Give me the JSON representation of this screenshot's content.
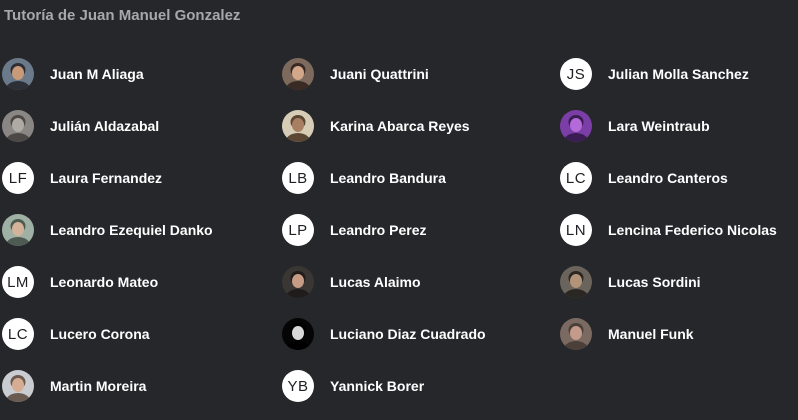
{
  "page": {
    "title": "Tutoría de Juan Manuel Gonzalez"
  },
  "members": [
    {
      "name": "Juan M Aliaga",
      "avatar": {
        "kind": "photo",
        "colors": [
          "#6b7a8a",
          "#c89a78",
          "#2c2f36"
        ]
      }
    },
    {
      "name": "Juani Quattrini",
      "avatar": {
        "kind": "photo",
        "colors": [
          "#7d6a5d",
          "#d2a78a",
          "#3a2a24"
        ]
      }
    },
    {
      "name": "Julian Molla Sanchez",
      "avatar": {
        "kind": "initials",
        "initials": "JS"
      }
    },
    {
      "name": "Julián Aldazabal",
      "avatar": {
        "kind": "photo",
        "colors": [
          "#8a8683",
          "#b0aaa4",
          "#4b4846"
        ]
      }
    },
    {
      "name": "Karina Abarca Reyes",
      "avatar": {
        "kind": "photo",
        "colors": [
          "#d7cdb7",
          "#a87f62",
          "#5b4634"
        ]
      }
    },
    {
      "name": "Lara Weintraub",
      "avatar": {
        "kind": "photo",
        "colors": [
          "#7b3ea6",
          "#b46ad8",
          "#3a1d52"
        ]
      }
    },
    {
      "name": "Laura Fernandez",
      "avatar": {
        "kind": "initials",
        "initials": "LF"
      }
    },
    {
      "name": "Leandro Bandura",
      "avatar": {
        "kind": "initials",
        "initials": "LB"
      }
    },
    {
      "name": "Leandro Canteros",
      "avatar": {
        "kind": "initials",
        "initials": "LC"
      }
    },
    {
      "name": "Leandro Ezequiel Danko",
      "avatar": {
        "kind": "photo",
        "colors": [
          "#9fb1a4",
          "#d3b39a",
          "#4e5b52"
        ]
      }
    },
    {
      "name": "Leandro Perez",
      "avatar": {
        "kind": "initials",
        "initials": "LP"
      }
    },
    {
      "name": "Lencina Federico Nicolas",
      "avatar": {
        "kind": "initials",
        "initials": "LN"
      }
    },
    {
      "name": "Leonardo Mateo",
      "avatar": {
        "kind": "initials",
        "initials": "LM"
      }
    },
    {
      "name": "Lucas Alaimo",
      "avatar": {
        "kind": "photo",
        "colors": [
          "#3a3634",
          "#c79c84",
          "#1f1c1b"
        ]
      }
    },
    {
      "name": "Lucas Sordini",
      "avatar": {
        "kind": "photo",
        "colors": [
          "#6a645c",
          "#b39479",
          "#2a2622"
        ]
      }
    },
    {
      "name": "Lucero Corona",
      "avatar": {
        "kind": "initials",
        "initials": "LC"
      }
    },
    {
      "name": "Luciano Diaz Cuadrado",
      "avatar": {
        "kind": "photo",
        "colors": [
          "#050505",
          "#d8d8d8",
          "#000000"
        ]
      }
    },
    {
      "name": "Manuel Funk",
      "avatar": {
        "kind": "photo",
        "colors": [
          "#7b6a62",
          "#c49b8a",
          "#4b3f3a"
        ]
      }
    },
    {
      "name": "Martin Moreira",
      "avatar": {
        "kind": "photo",
        "colors": [
          "#c9ccd1",
          "#d6ad93",
          "#6a5a4f"
        ]
      }
    },
    {
      "name": "Yannick Borer",
      "avatar": {
        "kind": "initials",
        "initials": "YB"
      }
    }
  ],
  "theme": {
    "background": "#26272b",
    "title_color": "#a7a8ab",
    "name_color": "#ffffff",
    "initials_bg": "#ffffff",
    "initials_fg": "#202124"
  }
}
